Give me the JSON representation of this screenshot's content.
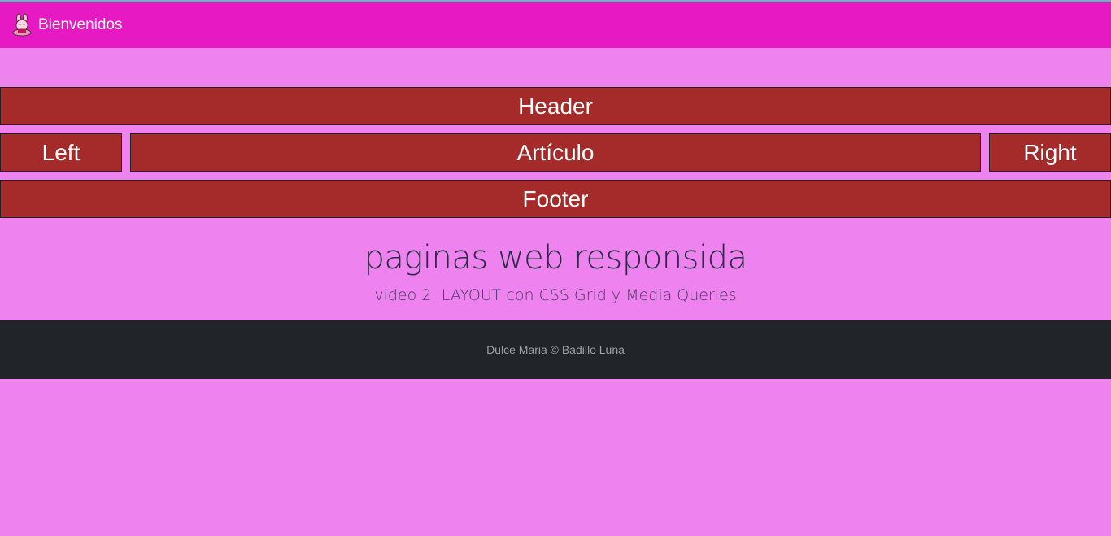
{
  "navbar": {
    "brand_label": "Bienvenidos",
    "brand_icon": "bunny-logo-icon",
    "background": "#e619c3"
  },
  "grid": {
    "header_label": "Header",
    "left_label": "Left",
    "article_label": "Artículo",
    "right_label": "Right",
    "footer_label": "Footer",
    "box_color": "#a52a2a"
  },
  "hero": {
    "title": "paginas web responsida",
    "subtitle": "video 2: LAYOUT con CSS Grid y Media Queries"
  },
  "site_footer": {
    "text": "Dulce Maria © Badillo Luna",
    "background": "#212529"
  },
  "page": {
    "background": "#ee82ee"
  }
}
